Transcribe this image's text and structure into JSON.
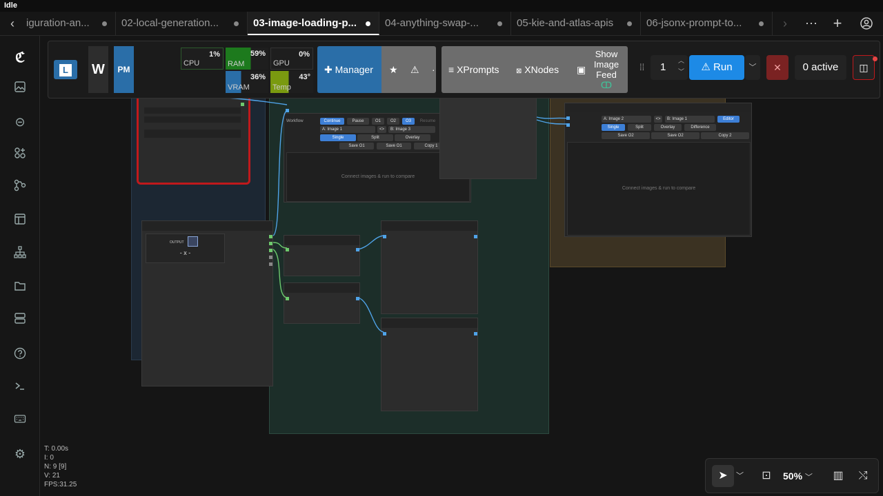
{
  "window": {
    "title": "Idle"
  },
  "tabs": [
    {
      "label": "iguration-an..."
    },
    {
      "label": "02-local-generation..."
    },
    {
      "label": "03-image-loading-p..."
    },
    {
      "label": "04-anything-swap-..."
    },
    {
      "label": "05-kie-and-atlas-apis"
    },
    {
      "label": "06-jsonx-prompt-to..."
    }
  ],
  "toolbar": {
    "logo_l": "L",
    "logo_w": "W",
    "logo_pm": "PM",
    "metrics": {
      "cpu": {
        "label": "CPU",
        "value": "1%"
      },
      "ram": {
        "label": "RAM",
        "value": "59%"
      },
      "gpu": {
        "label": "GPU",
        "value": "0%"
      },
      "vram": {
        "label": "VRAM",
        "value": "36%"
      },
      "temp": {
        "label": "Temp",
        "value": "43°"
      }
    },
    "manager_label": "Manager",
    "xprompts_label": "XPrompts",
    "xnodes_label": "XNodes",
    "show_image_feed_label": "Show Image Feed",
    "queue_count": "1",
    "run_label": "Run",
    "active_label": "0 active"
  },
  "nodes": {
    "output_label": "OUTPUT",
    "output_value": "- x -",
    "compare_top": {
      "workflow_label": "Workflow",
      "continue": "Continue",
      "pause": "Pause",
      "o1": "O1",
      "o2": "O2",
      "o3": "O3",
      "resume": "Resume",
      "a_image": "A: Image 1",
      "swap": "<>",
      "b_image": "B: Image 3",
      "single": "Single",
      "split": "Split",
      "overlay": "Overlay",
      "save_o1": "Save O1",
      "save_o1b": "Save O1",
      "copy1": "Copy 1",
      "empty": "Connect images & run to compare"
    },
    "compare_right": {
      "a_image": "A: Image 2",
      "swap": "<>",
      "b_image": "B: Image 1",
      "editor": "Editor",
      "single": "Single",
      "split": "Split",
      "overlay": "Overlay",
      "difference": "Difference",
      "save_o2": "Save O2",
      "save_o2b": "Save O2",
      "copy2": "Copy 2",
      "empty": "Connect images & run to compare"
    }
  },
  "stats": {
    "t": "T: 0.00s",
    "i": "I: 0",
    "n": "N: 9 [9]",
    "v": "V: 21",
    "fps": "FPS:31.25"
  },
  "zoom": {
    "label": "50%"
  }
}
